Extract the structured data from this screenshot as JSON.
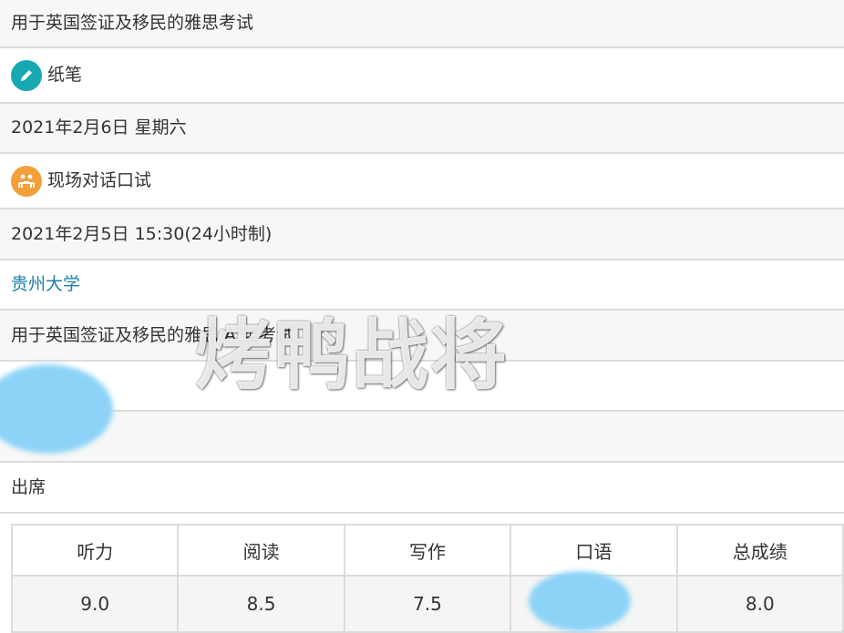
{
  "rows": {
    "exam_type": "用于英国签证及移民的雅思考试",
    "test_format": "纸笔",
    "written_test_date": "2021年2月6日 星期六",
    "speaking_format": "现场对话口试",
    "speaking_datetime": "2021年2月5日 15:30(24小时制)",
    "venue": "贵州大学",
    "exam_module": "用于英国签证及移民的雅思 A 类考试",
    "attendance": "出席"
  },
  "scores": {
    "headers": [
      "听力",
      "阅读",
      "写作",
      "口语",
      "总成绩"
    ],
    "values": [
      "9.0",
      "8.5",
      "7.5",
      "",
      "8.0"
    ]
  },
  "watermark": "烤鸭战将",
  "icons": {
    "test_format": "pencil-icon",
    "speaking_format": "people-talking-icon"
  },
  "colors": {
    "link": "#1d7fa8",
    "teal_icon": "#18a8b4",
    "orange_icon": "#f2a03a",
    "redaction": "#8cd3f7"
  }
}
